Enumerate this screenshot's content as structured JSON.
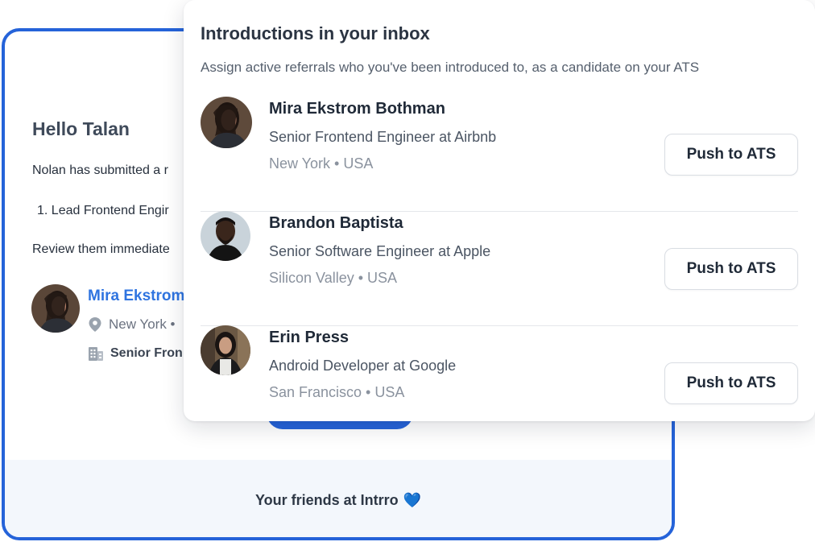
{
  "email": {
    "greeting": "Hello Talan",
    "line1": "Nolan has submitted a r",
    "line2": "1. Lead Frontend Engir",
    "line3": "Review them immediate",
    "candidate": {
      "name": "Mira Ekstrom",
      "location": "New York •",
      "role": "Senior Fron"
    },
    "footer": "Your friends at Intrro",
    "footer_emoji": "💙"
  },
  "panel": {
    "title": "Introductions in your inbox",
    "subtitle": "Assign active referrals who you've been introduced to, as a candidate on your ATS",
    "intros": [
      {
        "name": "Mira Ekstrom Bothman",
        "title": "Senior Frontend Engineer at Airbnb",
        "location": "New York • USA",
        "button": "Push to ATS"
      },
      {
        "name": "Brandon Baptista",
        "title": "Senior Software Engineer at Apple",
        "location": "Silicon Valley • USA",
        "button": "Push to ATS"
      },
      {
        "name": "Erin Press",
        "title": "Android Developer at Google",
        "location": "San Francisco • USA",
        "button": "Push to ATS"
      }
    ]
  },
  "colors": {
    "accent": "#2563d9",
    "link": "#2f74e0",
    "footer_bg": "#f3f7fc"
  },
  "icons": [
    "map-pin-icon",
    "building-icon"
  ]
}
